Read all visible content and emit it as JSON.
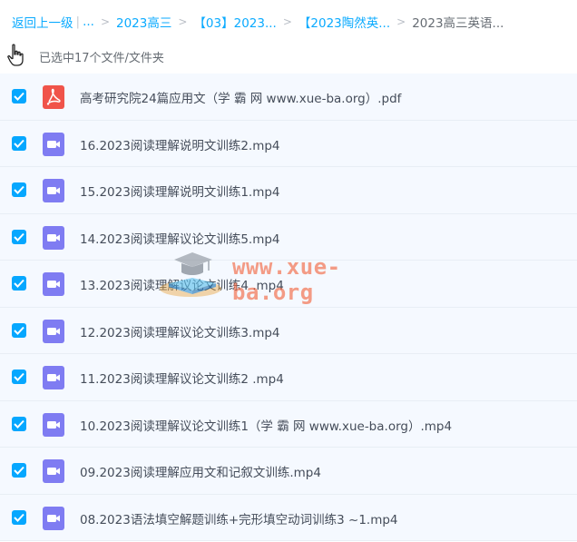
{
  "breadcrumb": {
    "back": "返回上一级",
    "ellipsis": "...",
    "items": [
      "2023高三",
      "【03】2023...",
      "【2023陶然英...",
      "2023高三英语..."
    ]
  },
  "selection": {
    "text": "已选中17个文件/文件夹"
  },
  "files": [
    {
      "name": "高考研究院24篇应用文（学 霸 网 www.xue-ba.org）.pdf",
      "type": "pdf-icon",
      "checked": true
    },
    {
      "name": "16.2023阅读理解说明文训练2.mp4",
      "type": "video-icon",
      "checked": true
    },
    {
      "name": "15.2023阅读理解说明文训练1.mp4",
      "type": "video-icon",
      "checked": true
    },
    {
      "name": "14.2023阅读理解议论文训练5.mp4",
      "type": "video-icon",
      "checked": true
    },
    {
      "name": "13.2023阅读理解议论文训练4 .mp4",
      "type": "video-icon",
      "checked": true
    },
    {
      "name": "12.2023阅读理解议论文训练3.mp4",
      "type": "video-icon",
      "checked": true
    },
    {
      "name": "11.2023阅读理解议论文训练2 .mp4",
      "type": "video-icon",
      "checked": true
    },
    {
      "name": "10.2023阅读理解议论文训练1（学 霸 网 www.xue-ba.org）.mp4",
      "type": "video-icon",
      "checked": true
    },
    {
      "name": "09.2023阅读理解应用文和记叙文训练.mp4",
      "type": "video-icon",
      "checked": true
    },
    {
      "name": "08.2023语法填空解题训练+完形填空动词训练3 ~1.mp4",
      "type": "video-icon",
      "checked": true
    }
  ],
  "watermark": {
    "text": "www.xue-ba.org"
  },
  "colors": {
    "accent": "#06a7ff",
    "pdf": "#f0544a",
    "video": "#7f7cf2",
    "row_bg": "#f5f9ff"
  }
}
